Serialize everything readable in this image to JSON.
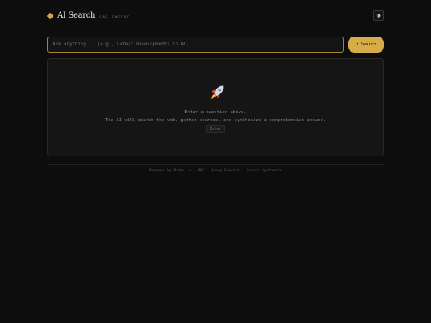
{
  "header": {
    "title": "AI Search",
    "subtitle": "RAG ENGINE",
    "logo_icon": "diamond-icon",
    "theme_toggle_icon": "half-circle-icon",
    "theme_toggle_glyph": "◑"
  },
  "search": {
    "placeholder": "Ask anything... (e.g., latest developments in AI)",
    "value": "",
    "button_label": "Search",
    "button_icon": "lightning-icon",
    "button_icon_glyph": "⚡"
  },
  "empty_state": {
    "icon": "rocket-icon",
    "title": "Enter a question above.",
    "description": "The AI will search the web, gather sources, and synthesize a comprehensive answer.",
    "hint_key": "Enter"
  },
  "footer": {
    "text": "Powered by Puter.js · RAG · Query Fan-Out · Source Synthesis"
  },
  "colors": {
    "accent": "#d6ab4a",
    "input_border": "#a2842f",
    "background": "#0d0d0d",
    "panel": "#151515"
  }
}
